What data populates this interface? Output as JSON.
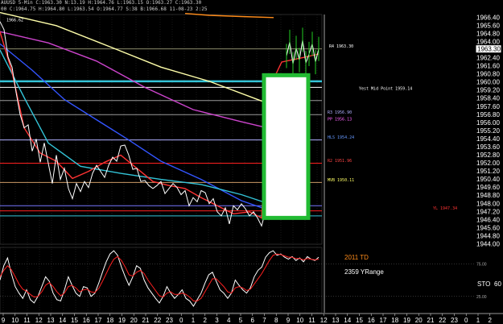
{
  "header": {
    "line1": "AUUSD 5-Min C:1963.30 N:13.19 H:1964.76 L:1963.15 O:1963.27 C:1963.30",
    "line2": "00 C:1964.75 H:1964.80 L:1963.54 O:1964.77 S:38 B:1966.68 11-08-23 2:25"
  },
  "chart_data": [
    {
      "type": "line",
      "title": "",
      "price_axis": {
        "ticks": [
          1966.4,
          1965.6,
          1964.8,
          1964.0,
          1963.3,
          1962.4,
          1961.6,
          1960.8,
          1960.0,
          1959.2,
          1958.4,
          1957.6,
          1956.8,
          1956.0,
          1955.2,
          1954.4,
          1953.6,
          1952.8,
          1952.0,
          1951.2,
          1950.4,
          1949.6,
          1948.8,
          1948.0,
          1947.2,
          1946.4,
          1945.6,
          1944.8,
          1944.0
        ],
        "tick_labels": [
          "1966.40",
          "1965.60",
          "1964.80",
          "1964.00",
          "1963.30",
          "1962.40",
          "1961.60",
          "1960.80",
          "1960.00",
          "1959.20",
          "1958.40",
          "1957.60",
          "1956.80",
          "1956.00",
          "1955.20",
          "1954.40",
          "1953.60",
          "1952.80",
          "1952.00",
          "1951.20",
          "1950.40",
          "1949.60",
          "1948.80",
          "1948.00",
          "1947.20",
          "1946.40",
          "1945.60",
          "1944.80",
          "1944.00"
        ],
        "current_price": "1963.30",
        "ylim": [
          1944.0,
          1966.7
        ]
      },
      "time_axis": {
        "labels": [
          "9",
          "10",
          "11",
          "12",
          "13",
          "14",
          "15",
          "16",
          "17",
          "18",
          "19",
          "20",
          "21",
          "22",
          "23",
          "0",
          "1",
          "2",
          "3",
          "4",
          "5",
          "6",
          "7",
          "8",
          "9",
          "10",
          "11",
          "12",
          "13",
          "14",
          "15",
          "16",
          "17",
          "18",
          "19",
          "20",
          "21",
          "22",
          "23",
          "0",
          "1",
          "2"
        ]
      },
      "annotations": [
        {
          "label": "1966.62",
          "price": 1965.9,
          "color": "#ffffff"
        },
        {
          "label": "R4 1963.30",
          "price": 1963.3,
          "color": "#ffffff"
        },
        {
          "label": "Yest Mid Point 1959.14",
          "price": 1959.14,
          "color": "#ffffff"
        },
        {
          "label": "R3 1956.90",
          "price": 1956.8,
          "color": "#b0b0ff"
        },
        {
          "label": "PP 1956.13",
          "price": 1956.1,
          "color": "#ff66ff"
        },
        {
          "label": "HLS 1954.24",
          "price": 1954.3,
          "color": "#6699ff"
        },
        {
          "label": "R2 1951.96",
          "price": 1952.0,
          "color": "#ff4444"
        },
        {
          "label": "MVB 1950.11",
          "price": 1950.1,
          "color": "#ffff66"
        },
        {
          "label": "YL 1947.34",
          "price": 1947.3,
          "color": "#ff3333"
        }
      ],
      "horizontal_levels": [
        {
          "price": 1963.3,
          "color": "#8a8a6a"
        },
        {
          "price": 1960.1,
          "color": "#33c4d8",
          "thick": true
        },
        {
          "price": 1959.5,
          "color": "#ffffff"
        },
        {
          "price": 1958.2,
          "color": "#9a9a9a"
        },
        {
          "price": 1956.8,
          "color": "#9a9a9a"
        },
        {
          "price": 1954.3,
          "color": "#b0b0ff"
        },
        {
          "price": 1952.0,
          "color": "#ff2020"
        },
        {
          "price": 1950.1,
          "color": "#cc9966"
        },
        {
          "price": 1947.3,
          "color": "#ff2020"
        },
        {
          "price": 1947.8,
          "color": "#7777ff"
        },
        {
          "price": 1946.8,
          "color": "#33c4d8"
        }
      ],
      "moving_averages": [
        {
          "name": "",
          "color": "#ffffaa",
          "points": [
            [
              0,
              1966.9
            ],
            [
              70,
              1965.6
            ],
            [
              140,
              1963.4
            ],
            [
              200,
              1961.5
            ],
            [
              260,
              1960.1
            ],
            [
              330,
              1958.0
            ]
          ]
        },
        {
          "name": "",
          "color": "#cc44cc",
          "points": [
            [
              0,
              1965.0
            ],
            [
              60,
              1963.9
            ],
            [
              120,
              1962.1
            ],
            [
              180,
              1959.5
            ],
            [
              240,
              1957.3
            ],
            [
              300,
              1956.1
            ],
            [
              380,
              1954.6
            ]
          ]
        },
        {
          "name": "",
          "color": "#3355ff",
          "points": [
            [
              0,
              1963.8
            ],
            [
              40,
              1961.2
            ],
            [
              80,
              1958.3
            ],
            [
              120,
              1956.3
            ],
            [
              160,
              1954.3
            ],
            [
              200,
              1952.2
            ],
            [
              250,
              1950.4
            ],
            [
              300,
              1948.3
            ],
            [
              340,
              1947.2
            ]
          ]
        },
        {
          "name": "",
          "color": "#33c4d8",
          "points": [
            [
              0,
              1963.2
            ],
            [
              30,
              1958.5
            ],
            [
              60,
              1954.0
            ],
            [
              100,
              1951.7
            ],
            [
              150,
              1951.0
            ],
            [
              200,
              1950.4
            ],
            [
              250,
              1949.9
            ],
            [
              300,
              1948.9
            ],
            [
              330,
              1948.1
            ]
          ]
        },
        {
          "name": "",
          "color": "#ff8c1a",
          "points": [
            [
              230,
              1966.8
            ],
            [
              260,
              1966.62
            ],
            [
              300,
              1966.5
            ],
            [
              340,
              1966.4
            ]
          ]
        },
        {
          "name": "",
          "color": "#ff3333",
          "points": [
            [
              0,
              1965.0
            ],
            [
              15,
              1961.0
            ],
            [
              30,
              1955.5
            ],
            [
              50,
              1953.0
            ],
            [
              70,
              1952.2
            ],
            [
              90,
              1950.5
            ],
            [
              110,
              1951.2
            ],
            [
              130,
              1952.1
            ],
            [
              150,
              1952.8
            ],
            [
              170,
              1951.5
            ],
            [
              190,
              1950.2
            ],
            [
              210,
              1949.8
            ],
            [
              230,
              1949.5
            ],
            [
              250,
              1948.6
            ],
            [
              270,
              1947.8
            ],
            [
              290,
              1947.0
            ],
            [
              310,
              1947.2
            ],
            [
              325,
              1946.6
            ],
            [
              335,
              1959.5
            ],
            [
              350,
              1962.0
            ],
            [
              380,
              1962.5
            ],
            [
              396,
              1962.8
            ]
          ]
        }
      ],
      "price_series": {
        "name": "",
        "color": "#ffffff",
        "points": [
          [
            0,
            1966.0
          ],
          [
            5,
            1965.2
          ],
          [
            10,
            1962.5
          ],
          [
            15,
            1961.5
          ],
          [
            20,
            1959.0
          ],
          [
            25,
            1956.8
          ],
          [
            30,
            1955.5
          ],
          [
            35,
            1955.8
          ],
          [
            40,
            1953.2
          ],
          [
            45,
            1954.4
          ],
          [
            50,
            1952.1
          ],
          [
            55,
            1954.0
          ],
          [
            60,
            1952.0
          ],
          [
            65,
            1950.0
          ],
          [
            70,
            1952.8
          ],
          [
            75,
            1950.4
          ],
          [
            80,
            1951.5
          ],
          [
            85,
            1949.5
          ],
          [
            90,
            1948.5
          ],
          [
            95,
            1950.0
          ],
          [
            100,
            1949.2
          ],
          [
            105,
            1950.2
          ],
          [
            110,
            1949.6
          ],
          [
            115,
            1951.0
          ],
          [
            120,
            1951.8
          ],
          [
            125,
            1951.2
          ],
          [
            130,
            1950.6
          ],
          [
            135,
            1951.8
          ],
          [
            140,
            1952.6
          ],
          [
            145,
            1952.2
          ],
          [
            150,
            1953.7
          ],
          [
            155,
            1953.8
          ],
          [
            160,
            1952.8
          ],
          [
            165,
            1951.4
          ],
          [
            170,
            1951.5
          ],
          [
            175,
            1950.2
          ],
          [
            180,
            1950.3
          ],
          [
            185,
            1949.8
          ],
          [
            190,
            1949.5
          ],
          [
            195,
            1949.8
          ],
          [
            200,
            1950.2
          ],
          [
            205,
            1949.0
          ],
          [
            210,
            1949.5
          ],
          [
            215,
            1950.0
          ],
          [
            220,
            1949.6
          ],
          [
            225,
            1948.9
          ],
          [
            230,
            1949.3
          ],
          [
            235,
            1947.8
          ],
          [
            240,
            1948.6
          ],
          [
            245,
            1948.2
          ],
          [
            250,
            1949.3
          ],
          [
            255,
            1949.1
          ],
          [
            260,
            1948.0
          ],
          [
            265,
            1948.5
          ],
          [
            270,
            1947.2
          ],
          [
            275,
            1946.8
          ],
          [
            280,
            1947.6
          ],
          [
            285,
            1946.0
          ],
          [
            290,
            1947.8
          ],
          [
            295,
            1947.4
          ],
          [
            300,
            1948.0
          ],
          [
            305,
            1947.5
          ],
          [
            310,
            1946.8
          ],
          [
            315,
            1947.2
          ],
          [
            320,
            1946.6
          ],
          [
            325,
            1945.8
          ],
          [
            330,
            1947.3
          ]
        ],
        "late_points": [
          [
            356,
            1962.6
          ],
          [
            360,
            1964.0
          ],
          [
            364,
            1961.8
          ],
          [
            368,
            1963.4
          ],
          [
            372,
            1962.2
          ],
          [
            376,
            1964.2
          ],
          [
            380,
            1961.9
          ],
          [
            384,
            1962.8
          ],
          [
            388,
            1963.8
          ],
          [
            392,
            1962.0
          ],
          [
            396,
            1963.3
          ]
        ]
      }
    },
    {
      "type": "line",
      "title": "",
      "labels": {
        "td": "2011 TD",
        "yrange": "2359 YRange",
        "sto": "STO",
        "sto_value": "60"
      },
      "y_ticks": [
        "75.00",
        "25.00"
      ],
      "ylim": [
        0,
        100
      ],
      "series": [
        {
          "name": "",
          "color": "#ffffff",
          "values": [
            50,
            72,
            84,
            60,
            40,
            30,
            22,
            35,
            20,
            15,
            25,
            40,
            55,
            48,
            30,
            20,
            18,
            35,
            55,
            42,
            30,
            25,
            40,
            38,
            25,
            30,
            45,
            62,
            78,
            90,
            95,
            88,
            70,
            55,
            42,
            55,
            72,
            68,
            50,
            38,
            30,
            22,
            15,
            25,
            40,
            30,
            22,
            28,
            35,
            22,
            18,
            10,
            20,
            30,
            45,
            58,
            62,
            48,
            35,
            30,
            22,
            30,
            50,
            42,
            35,
            30,
            38,
            55,
            65,
            70,
            85,
            92,
            95,
            88,
            90,
            85,
            82,
            86,
            80,
            84,
            78,
            86,
            82,
            80,
            85
          ]
        },
        {
          "name": "",
          "color": "#ff2020",
          "values": [
            55,
            65,
            72,
            66,
            55,
            44,
            36,
            33,
            28,
            24,
            25,
            32,
            42,
            46,
            40,
            32,
            26,
            30,
            40,
            42,
            38,
            32,
            35,
            36,
            32,
            31,
            37,
            48,
            60,
            72,
            82,
            86,
            80,
            70,
            58,
            56,
            62,
            65,
            60,
            50,
            42,
            34,
            26,
            24,
            30,
            32,
            28,
            28,
            30,
            28,
            24,
            18,
            18,
            22,
            32,
            42,
            52,
            52,
            46,
            40,
            32,
            30,
            38,
            40,
            38,
            34,
            36,
            44,
            52,
            60,
            70,
            80,
            88,
            90,
            89,
            87,
            85,
            85,
            83,
            83,
            81,
            83,
            82,
            81,
            82
          ]
        }
      ]
    }
  ]
}
